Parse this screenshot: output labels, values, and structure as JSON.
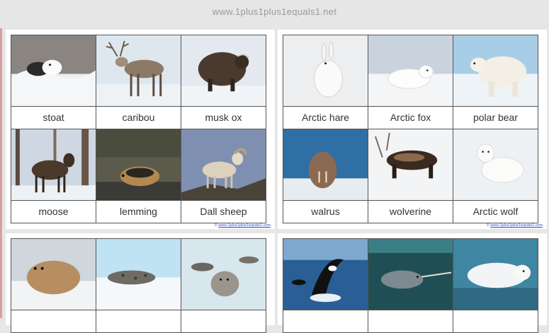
{
  "header": {
    "site_url": "www.1plus1plus1equals1.net"
  },
  "panels": [
    {
      "copyright_prefix": "©",
      "copyright_link": "www.1plus1plus1equals1.com",
      "cards": [
        {
          "label": "stoat",
          "image": "stoat-in-snow"
        },
        {
          "label": "caribou",
          "image": "caribou-on-snow"
        },
        {
          "label": "musk ox",
          "image": "musk-ox-in-snow"
        },
        {
          "label": "moose",
          "image": "moose-in-forest"
        },
        {
          "label": "lemming",
          "image": "lemming-on-rocks"
        },
        {
          "label": "Dall sheep",
          "image": "dall-sheep-on-rocks"
        }
      ]
    },
    {
      "copyright_prefix": "©",
      "copyright_link": "www.1plus1plus1equals1.com",
      "cards": [
        {
          "label": "Arctic hare",
          "image": "arctic-hare-in-snow"
        },
        {
          "label": "Arctic fox",
          "image": "arctic-fox-in-snow"
        },
        {
          "label": "polar bear",
          "image": "polar-bear-on-ice"
        },
        {
          "label": "walrus",
          "image": "walrus-by-sea"
        },
        {
          "label": "wolverine",
          "image": "wolverine-in-snow"
        },
        {
          "label": "Arctic wolf",
          "image": "arctic-wolf-in-snow"
        }
      ]
    },
    {
      "cards": [
        {
          "label": "",
          "image": "bearded-seal-on-ice"
        },
        {
          "label": "",
          "image": "harp-seal-on-ice"
        },
        {
          "label": "",
          "image": "seals-on-ice-floe"
        }
      ]
    },
    {
      "cards": [
        {
          "label": "",
          "image": "orca-breaching"
        },
        {
          "label": "",
          "image": "narwhal-underwater"
        },
        {
          "label": "",
          "image": "beluga-underwater"
        }
      ]
    }
  ]
}
